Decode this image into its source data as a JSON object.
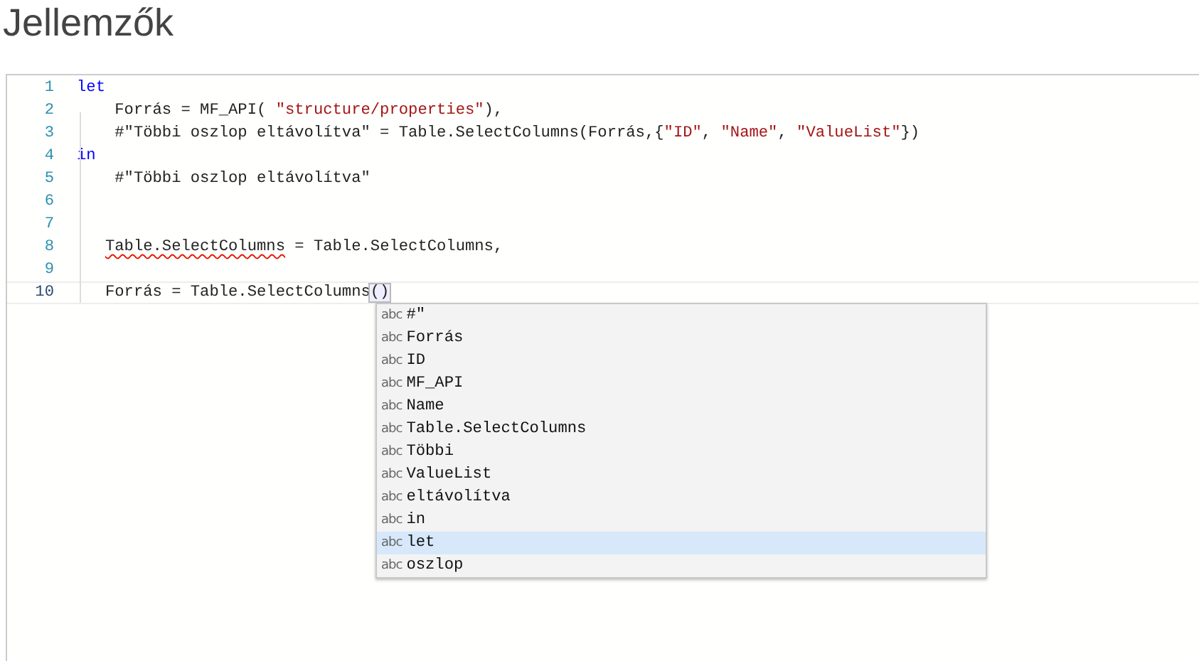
{
  "title": "Jellemzők",
  "editor": {
    "lines": [
      {
        "number": "1",
        "current": false,
        "tokens": [
          {
            "text": "let",
            "kind": "keyword"
          }
        ]
      },
      {
        "number": "2",
        "current": false,
        "tokens": [
          {
            "text": "    Forrás = MF_API( ",
            "kind": "plain"
          },
          {
            "text": "\"structure/properties\"",
            "kind": "string"
          },
          {
            "text": "),",
            "kind": "plain"
          }
        ]
      },
      {
        "number": "3",
        "current": false,
        "tokens": [
          {
            "text": "    #\"Többi oszlop eltávolítva\" = Table.SelectColumns(Forrás,{",
            "kind": "plain"
          },
          {
            "text": "\"ID\"",
            "kind": "string"
          },
          {
            "text": ", ",
            "kind": "plain"
          },
          {
            "text": "\"Name\"",
            "kind": "string"
          },
          {
            "text": ", ",
            "kind": "plain"
          },
          {
            "text": "\"ValueList\"",
            "kind": "string"
          },
          {
            "text": "})",
            "kind": "plain"
          }
        ]
      },
      {
        "number": "4",
        "current": false,
        "tokens": [
          {
            "text": "in",
            "kind": "keyword"
          }
        ]
      },
      {
        "number": "5",
        "current": false,
        "tokens": [
          {
            "text": "    #\"Többi oszlop eltávolítva\"",
            "kind": "plain"
          }
        ]
      },
      {
        "number": "6",
        "current": false
      },
      {
        "number": "7",
        "current": false
      },
      {
        "number": "8",
        "current": false,
        "tokens": [
          {
            "text": "   Table.SelectColumns",
            "kind": "error"
          },
          {
            "text": " = Table.SelectColumns,",
            "kind": "plain"
          }
        ]
      },
      {
        "number": "9",
        "current": false
      },
      {
        "number": "10",
        "current": true,
        "tokens": [
          {
            "text": "   Forrás = Table.SelectColumns",
            "kind": "plain"
          },
          {
            "text": "()",
            "kind": "match"
          }
        ]
      }
    ]
  },
  "autocomplete": {
    "items": [
      {
        "icon": "abc",
        "label": "#\"",
        "selected": false
      },
      {
        "icon": "abc",
        "label": "Forrás",
        "selected": false
      },
      {
        "icon": "abc",
        "label": "ID",
        "selected": false
      },
      {
        "icon": "abc",
        "label": "MF_API",
        "selected": false
      },
      {
        "icon": "abc",
        "label": "Name",
        "selected": false
      },
      {
        "icon": "abc",
        "label": "Table.SelectColumns",
        "selected": false
      },
      {
        "icon": "abc",
        "label": "Többi",
        "selected": false
      },
      {
        "icon": "abc",
        "label": "ValueList",
        "selected": false
      },
      {
        "icon": "abc",
        "label": "eltávolítva",
        "selected": false
      },
      {
        "icon": "abc",
        "label": "in",
        "selected": false
      },
      {
        "icon": "abc",
        "label": "let",
        "selected": true
      },
      {
        "icon": "abc",
        "label": "oszlop",
        "selected": false
      }
    ]
  }
}
